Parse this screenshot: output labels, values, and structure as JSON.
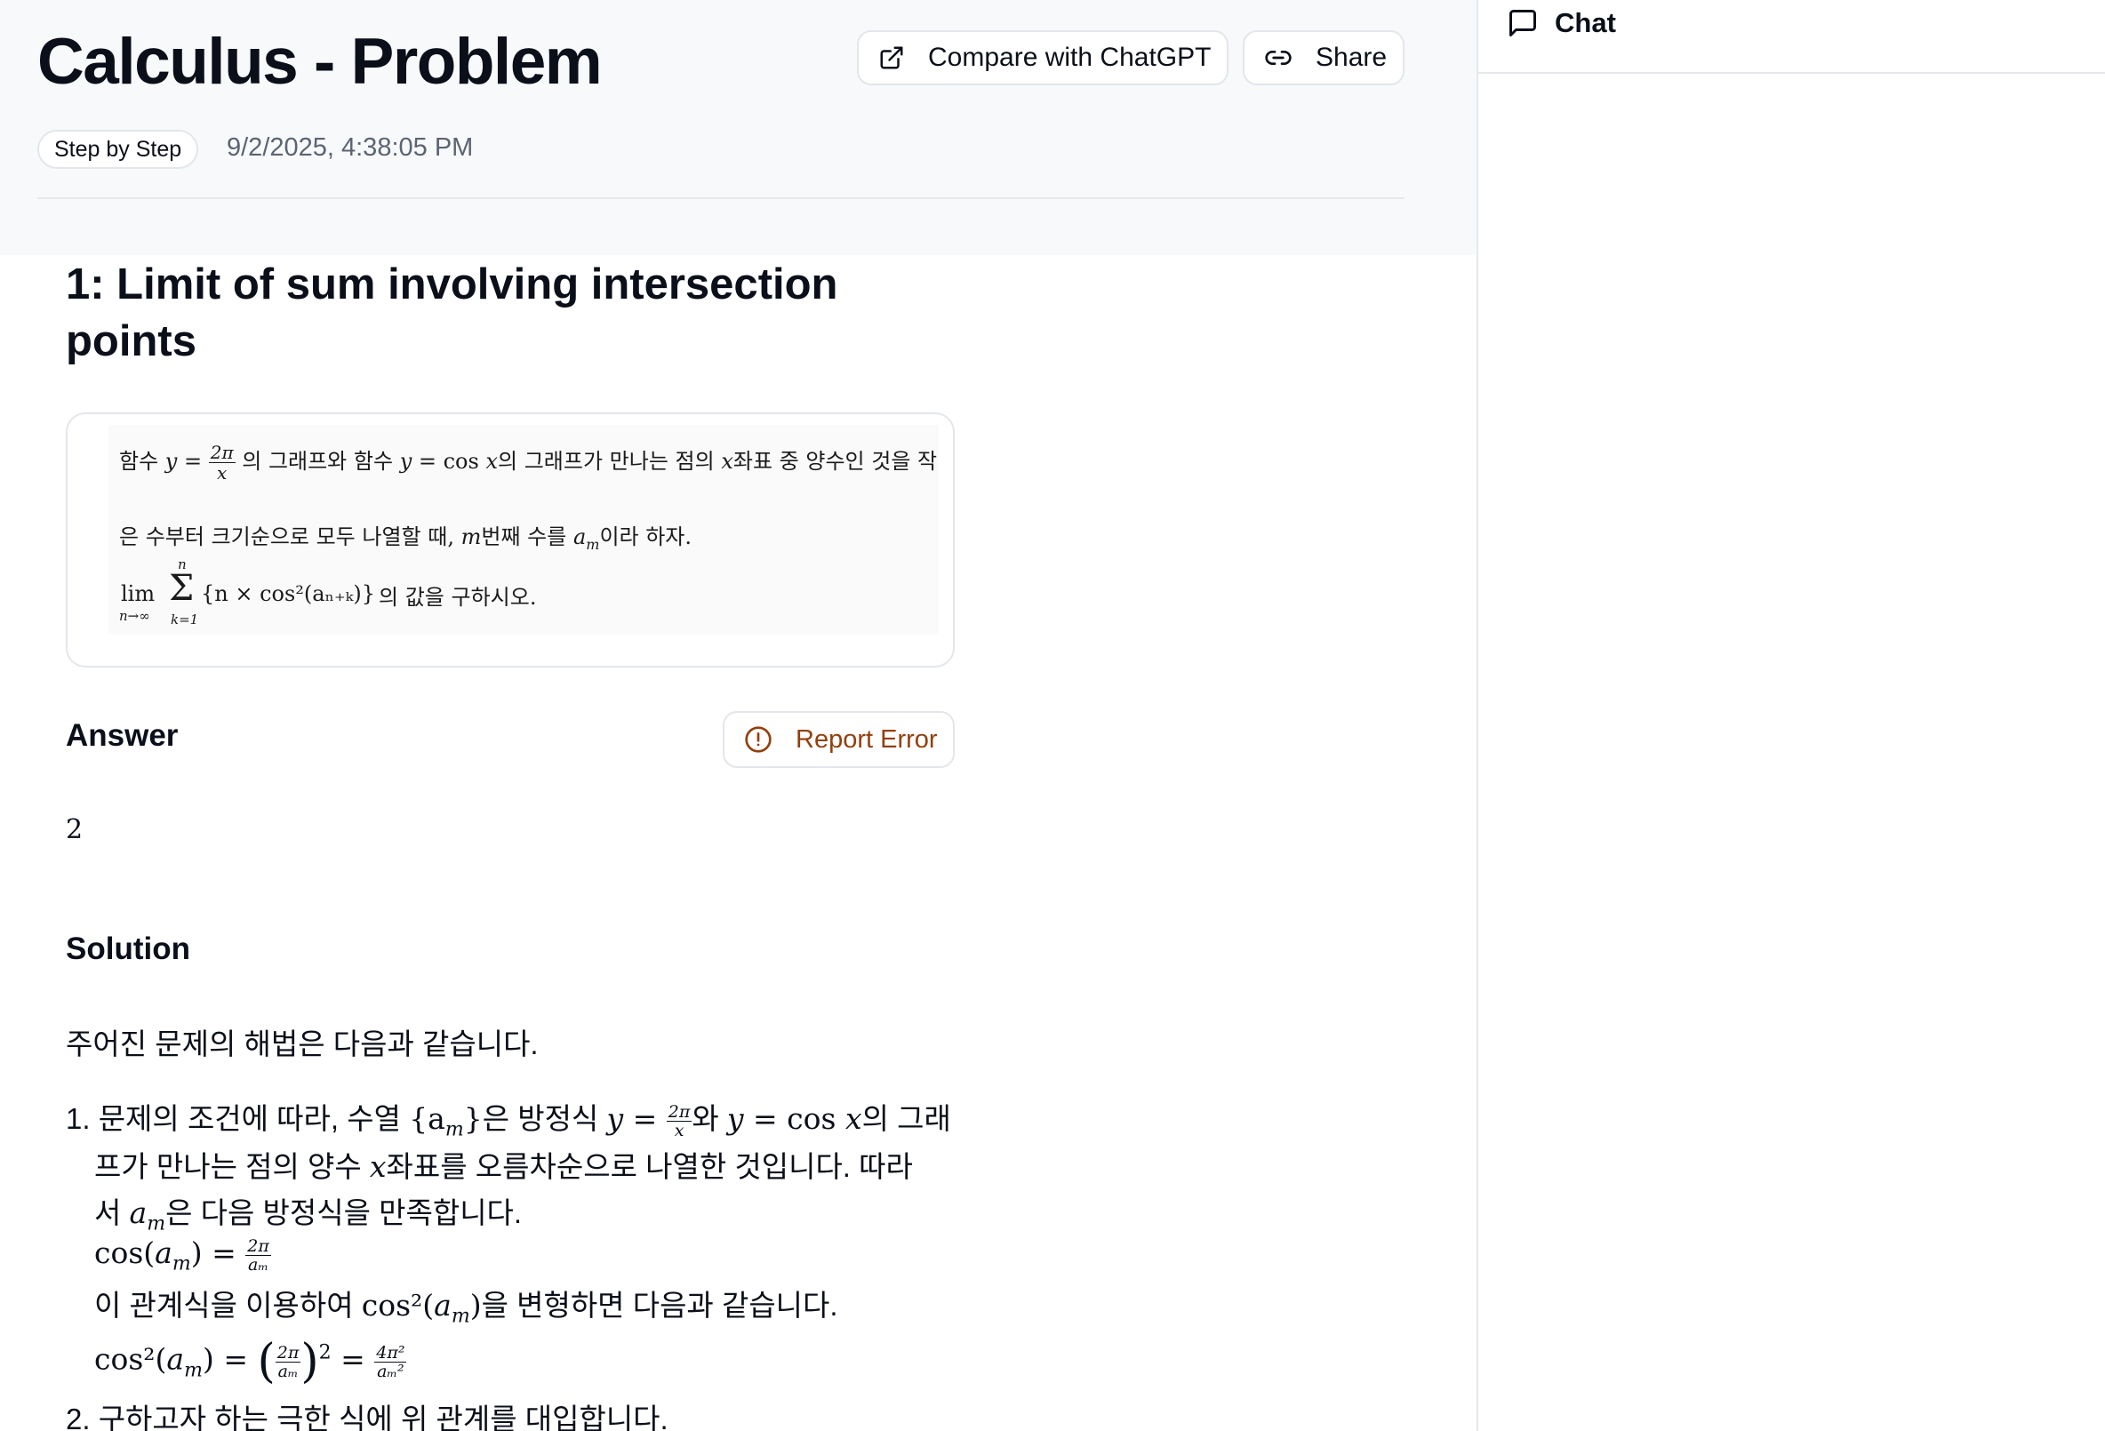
{
  "header": {
    "title": "Calculus - Problem",
    "compare_label": "Compare with ChatGPT",
    "share_label": "Share",
    "badge": "Step by Step",
    "timestamp": "9/2/2025, 4:38:05 PM"
  },
  "problem": {
    "title": "1: Limit of sum involving intersection points",
    "image_lines": {
      "l1_a": "함수 ",
      "l1_b": "y",
      "l1_c": " = ",
      "l1_num": "2π",
      "l1_den": "x",
      "l1_d": " 의 그래프와 함수 ",
      "l1_e": "y",
      "l1_f": " = cos ",
      "l1_g": "x",
      "l1_h": "의 그래프가 만나는 점의 ",
      "l1_i": "x",
      "l1_j": "좌표 중 양수인 것을 작",
      "l2_a": "은 수부터 크기순으로 모두 나열할 때, ",
      "l2_b": "m",
      "l2_c": "번째 수를 ",
      "l2_d": "a",
      "l2_e": "m",
      "l2_f": "이라 하자.",
      "l3_lim": "lim",
      "l3_sub": "n→∞",
      "l3_top": "n",
      "l3_sum": "Σ",
      "l3_bot": "k=1",
      "l3_expr": "{n × cos²(aₙ₊ₖ)}",
      "l3_tail": "의 값을 구하시오."
    }
  },
  "answer": {
    "heading": "Answer",
    "report_label": "Report Error",
    "value": "2"
  },
  "solution": {
    "heading": "Solution",
    "intro": "주어진 문제의 해법은 다음과 같습니다.",
    "s1_a": "1. 문제의 조건에 따라, 수열 ",
    "s1_b": "{a",
    "s1_c": "m",
    "s1_d": "}",
    "s1_e": "은 방정식 ",
    "s1_f": "y",
    "s1_g": " = ",
    "s1_num": "2π",
    "s1_den": "x",
    "s1_h": "와 ",
    "s1_i": "y",
    "s1_j": " = cos ",
    "s1_k": "x",
    "s1_l": "의 그래",
    "s2": "프가 만나는 점의 양수 ",
    "s2_x": "x",
    "s2_b": "좌표를 오름차순으로 나열한 것입니다. 따라",
    "s3_a": "서 ",
    "s3_b": "a",
    "s3_c": "m",
    "s3_d": "은 다음 방정식을 만족합니다.",
    "eq1_a": "cos(",
    "eq1_b": "a",
    "eq1_c": "m",
    "eq1_d": ") = ",
    "eq1_num": "2π",
    "eq1_den": "aₘ",
    "s4_a": "이 관계식을 이용하여 ",
    "s4_b": "cos²(",
    "s4_c": "a",
    "s4_d": "m",
    "s4_e": ")",
    "s4_f": "을 변형하면 다음과 같습니다.",
    "eq2_a": "cos²(",
    "eq2_b": "a",
    "eq2_c": "m",
    "eq2_d": ") = ",
    "eq2_lp": "(",
    "eq2_num": "2π",
    "eq2_den": "aₘ",
    "eq2_rp": ")",
    "eq2_exp": "2",
    "eq2_eq": " = ",
    "eq2_num2": "4π²",
    "eq2_den2": "aₘ²",
    "s5": "2. 구하고자 하는 극한 식에 위 관계를 대입합니다."
  },
  "sidebar": {
    "chat_label": "Chat"
  },
  "icons": {
    "compare": "external-link-icon",
    "share": "link-icon",
    "report": "alert-circle-icon",
    "chat": "chat-bubble-icon"
  },
  "colors": {
    "report_text": "#92400e",
    "header_bg": "#f8f9fb",
    "muted_text": "#5b6472"
  }
}
